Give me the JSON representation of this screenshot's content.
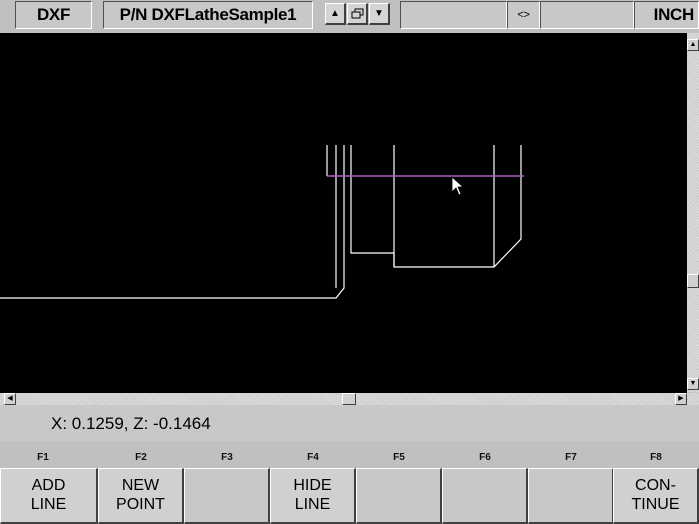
{
  "top_bar": {
    "mode": "DXF",
    "part_name": "P/N DXFLatheSample1",
    "field_blank": "",
    "coord_icon": "<>",
    "units": "INCH",
    "buttons": {
      "up": "▲",
      "window": "restore-window-icon",
      "down": "▼"
    }
  },
  "canvas": {
    "background": "#000000",
    "line_color": "#ffffff",
    "highlight_color": "#b060c0"
  },
  "status": {
    "coordinates": "X: 0.1259, Z: -0.1464"
  },
  "function_keys": [
    {
      "key": "F1",
      "label": "ADD\nLINE"
    },
    {
      "key": "F2",
      "label": "NEW\nPOINT"
    },
    {
      "key": "F3",
      "label": ""
    },
    {
      "key": "F4",
      "label": "HIDE\nLINE"
    },
    {
      "key": "F5",
      "label": ""
    },
    {
      "key": "F6",
      "label": ""
    },
    {
      "key": "F7",
      "label": ""
    },
    {
      "key": "F8",
      "label": "CON-\nTINUE"
    }
  ]
}
